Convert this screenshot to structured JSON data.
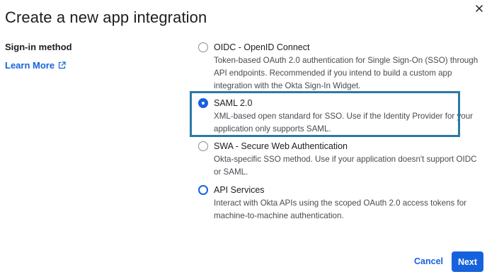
{
  "dialog": {
    "title": "Create a new app integration",
    "close_icon": "close-icon"
  },
  "sidebar": {
    "section_label": "Sign-in method",
    "learn_more_label": "Learn More",
    "learn_more_icon": "external-link-icon"
  },
  "options": [
    {
      "title": "OIDC - OpenID Connect",
      "description": "Token-based OAuth 2.0 authentication for Single Sign-On (SSO) through API endpoints. Recommended if you intend to build a custom app integration with the Okta Sign-In Widget.",
      "selected": false
    },
    {
      "title": "SAML 2.0",
      "description": "XML-based open standard for SSO. Use if the Identity Provider for your application only supports SAML.",
      "selected": true
    },
    {
      "title": "SWA - Secure Web Authentication",
      "description": "Okta-specific SSO method. Use if your application doesn't support OIDC or SAML.",
      "selected": false
    },
    {
      "title": "API Services",
      "description": "Interact with Okta APIs using the scoped OAuth 2.0 access tokens for machine-to-machine authentication.",
      "selected": false
    }
  ],
  "footer": {
    "cancel_label": "Cancel",
    "next_label": "Next"
  },
  "colors": {
    "accent": "#1662dd",
    "highlight_border": "#2a7aa3",
    "text": "#1d1d21",
    "secondary_text": "#4a4a52"
  }
}
